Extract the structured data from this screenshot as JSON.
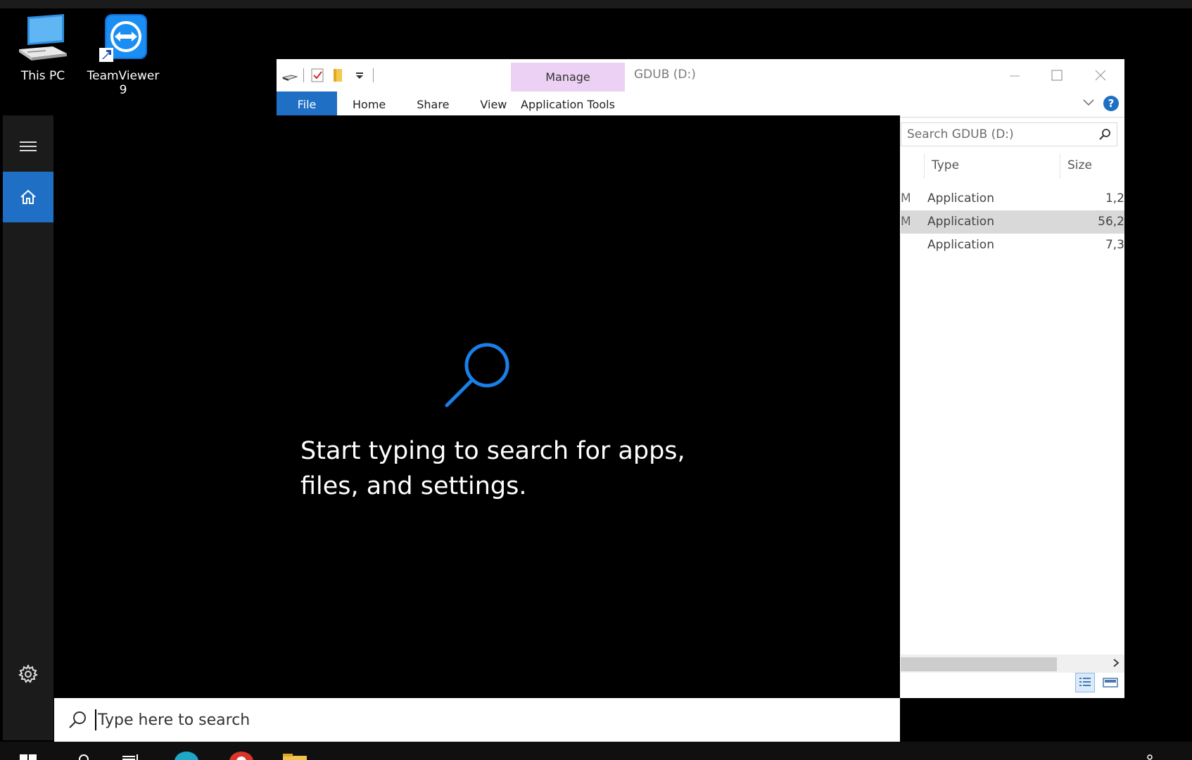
{
  "desktop": {
    "icons": [
      {
        "label": "This PC",
        "icon": "this-pc-icon"
      },
      {
        "label": "TeamViewer 9",
        "icon": "teamviewer-icon"
      }
    ]
  },
  "explorer": {
    "title": "GDUB (D:)",
    "contextual_tab_group": "Manage",
    "tabs": {
      "file": "File",
      "home": "Home",
      "share": "Share",
      "view": "View",
      "app_tools": "Application Tools"
    },
    "help_label": "?",
    "search_placeholder": "Search GDUB (D:)",
    "columns": {
      "type": "Type",
      "size": "Size"
    },
    "rows": [
      {
        "edge": "M",
        "type": "Application",
        "size": "1,2",
        "selected": false
      },
      {
        "edge": "M",
        "type": "Application",
        "size": "56,2",
        "selected": true
      },
      {
        "edge": "",
        "type": "Application",
        "size": "7,3",
        "selected": false
      }
    ],
    "colors": {
      "accent": "#1f6fc5",
      "manage_bg": "#ecd1f4",
      "selected_row": "#d9d9d9"
    }
  },
  "start_search": {
    "prompt": "Start typing to search for apps, files, and settings.",
    "search_placeholder": "Type here to search",
    "rail": {
      "menu_icon": "hamburger-icon",
      "home_icon": "home-icon",
      "settings_icon": "gear-icon"
    },
    "colors": {
      "accent": "#1f6fc5",
      "rail_bg": "#1b1b1b"
    }
  }
}
